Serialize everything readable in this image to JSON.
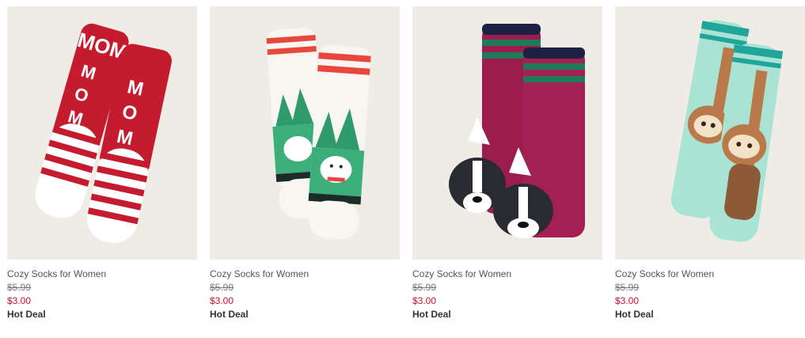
{
  "products": [
    {
      "name": "Cozy Socks for Women",
      "original_price": "$5.99",
      "sale_price": "$3.00",
      "badge": "Hot Deal",
      "image_label": "MOM",
      "colors": {
        "main": "#c41b2e",
        "accent": "#ffffff"
      }
    },
    {
      "name": "Cozy Socks for Women",
      "original_price": "$5.99",
      "sale_price": "$3.00",
      "badge": "Hot Deal",
      "colors": {
        "main": "#f7f6f1",
        "accent": "#e8473d",
        "trees": "#2f9b6a"
      }
    },
    {
      "name": "Cozy Socks for Women",
      "original_price": "$5.99",
      "sale_price": "$3.00",
      "badge": "Hot Deal",
      "colors": {
        "main": "#9c1c4c",
        "accent": "#1f7a5a",
        "cuff": "#1d2244"
      }
    },
    {
      "name": "Cozy Socks for Women",
      "original_price": "$5.99",
      "sale_price": "$3.00",
      "badge": "Hot Deal",
      "colors": {
        "main": "#a8e3d3",
        "accent": "#1fa59a",
        "sloth": "#b9794a"
      }
    }
  ]
}
